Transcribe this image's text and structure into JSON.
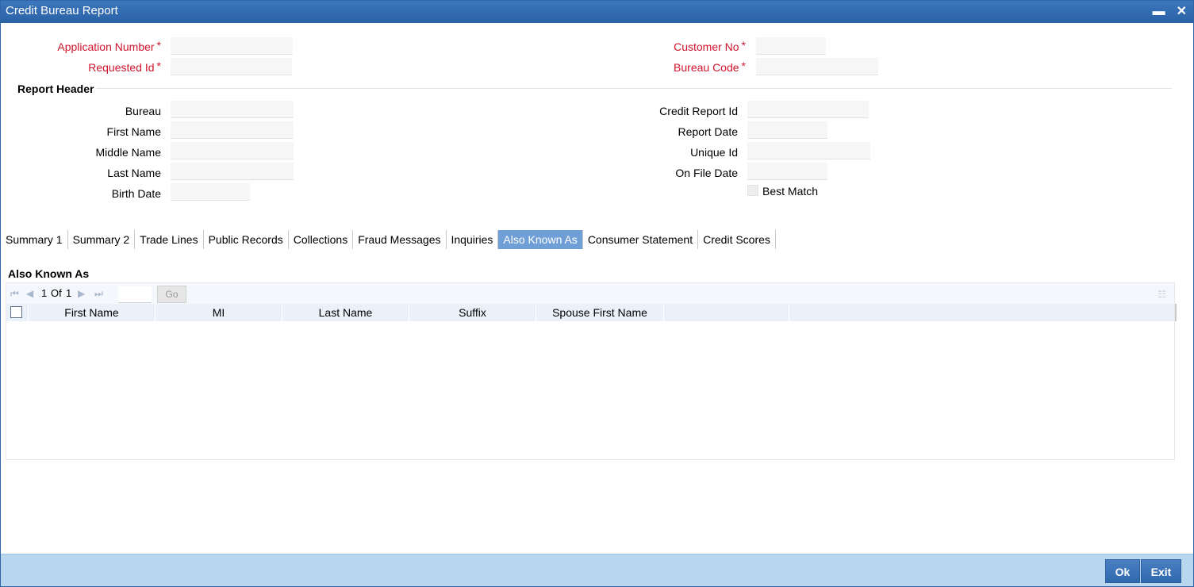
{
  "window": {
    "title": "Credit Bureau Report",
    "minimize": "▬",
    "close": "✕"
  },
  "required_fields": {
    "application_number": {
      "label": "Application Number",
      "value": ""
    },
    "requested_id": {
      "label": "Requested Id",
      "value": ""
    },
    "customer_no": {
      "label": "Customer No",
      "value": ""
    },
    "bureau_code": {
      "label": "Bureau Code",
      "value": ""
    },
    "required_marker": "*"
  },
  "report_header": {
    "title": "Report Header",
    "bureau": {
      "label": "Bureau",
      "value": ""
    },
    "first_name": {
      "label": "First Name",
      "value": ""
    },
    "middle_name": {
      "label": "Middle Name",
      "value": ""
    },
    "last_name": {
      "label": "Last Name",
      "value": ""
    },
    "birth_date": {
      "label": "Birth Date",
      "value": ""
    },
    "credit_report_id": {
      "label": "Credit Report Id",
      "value": ""
    },
    "report_date": {
      "label": "Report Date",
      "value": ""
    },
    "unique_id": {
      "label": "Unique Id",
      "value": ""
    },
    "on_file_date": {
      "label": "On File Date",
      "value": ""
    },
    "best_match": {
      "label": "Best Match",
      "checked": false
    }
  },
  "tabs": [
    {
      "label": "Summary 1",
      "active": false
    },
    {
      "label": "Summary 2",
      "active": false
    },
    {
      "label": "Trade Lines",
      "active": false
    },
    {
      "label": "Public Records",
      "active": false
    },
    {
      "label": "Collections",
      "active": false
    },
    {
      "label": "Fraud Messages",
      "active": false
    },
    {
      "label": "Inquiries",
      "active": false
    },
    {
      "label": "Also Known As",
      "active": true
    },
    {
      "label": "Consumer Statement",
      "active": false
    },
    {
      "label": "Credit Scores",
      "active": false
    }
  ],
  "grid": {
    "title": "Also Known As",
    "pager": {
      "current": "1",
      "of_label": "Of",
      "total": "1",
      "go_label": "Go",
      "page_input": ""
    },
    "columns": [
      "First Name",
      "MI",
      "Last Name",
      "Suffix",
      "Spouse First Name",
      ""
    ],
    "rows": []
  },
  "footer": {
    "ok_label": "Ok",
    "exit_label": "Exit"
  },
  "colors": {
    "titlebar": "#2f66a8",
    "required": "#d0142c",
    "active_tab": "#6f9fd6",
    "footer": "#b8d6ee"
  }
}
